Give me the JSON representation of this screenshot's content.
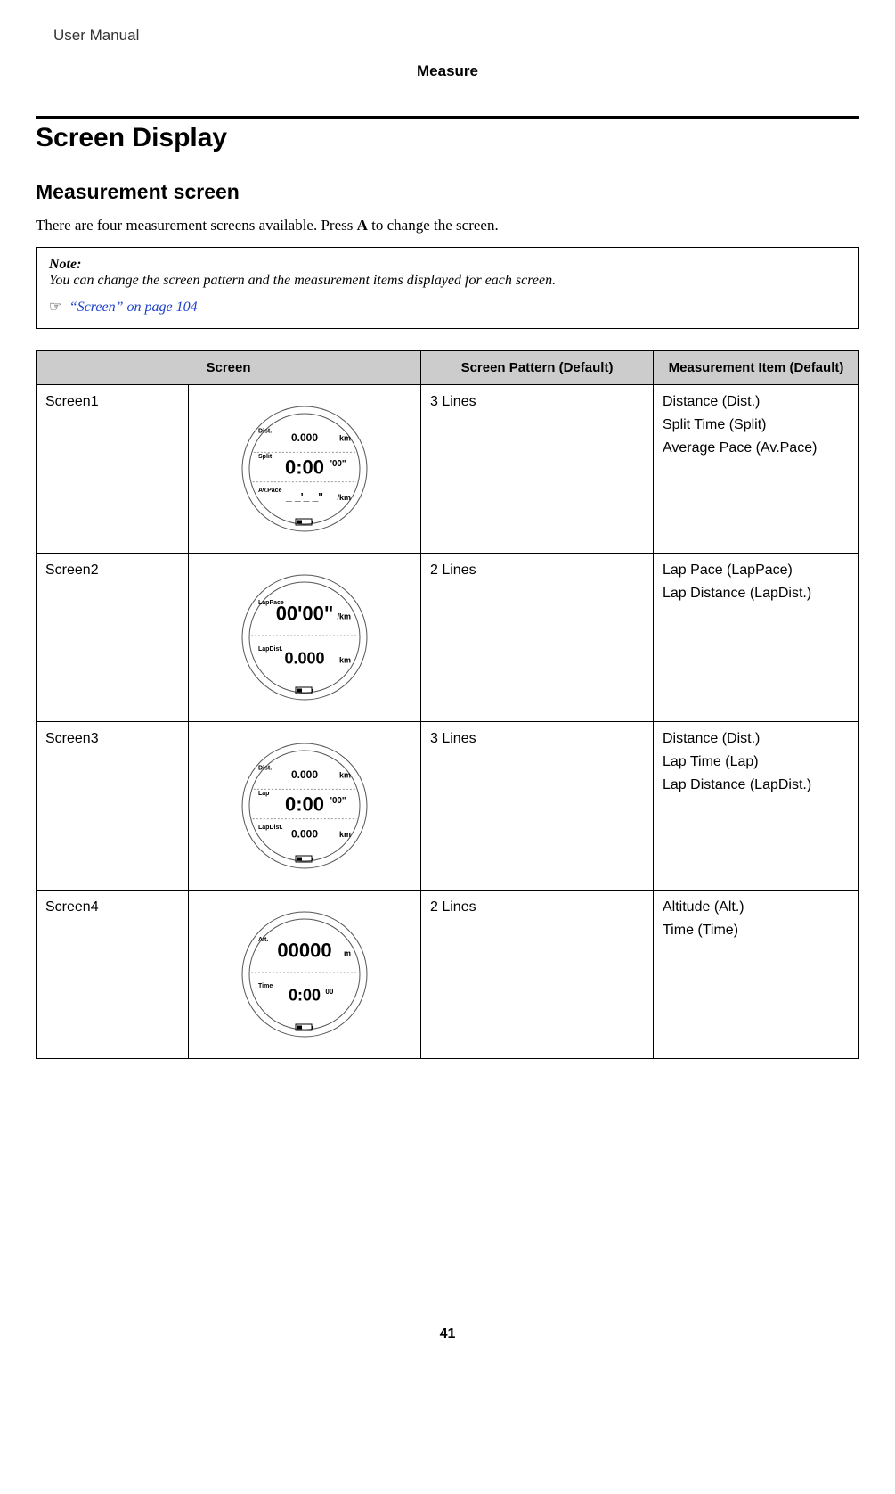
{
  "header": {
    "doc_title": "User Manual",
    "section": "Measure"
  },
  "h1": "Screen Display",
  "h2": "Measurement screen",
  "intro_prefix": "There are four measurement screens available. Press ",
  "intro_button": "A",
  "intro_suffix": " to change the screen.",
  "note": {
    "title": "Note:",
    "body": "You can change the screen pattern and the measurement items displayed for each screen.",
    "link": "“Screen” on page 104"
  },
  "table": {
    "headers": {
      "screen": "Screen",
      "pattern": "Screen Pattern (Default)",
      "item": "Measurement Item (Default)"
    },
    "rows": [
      {
        "name": "Screen1",
        "pattern": "3 Lines",
        "items": [
          "Distance (Dist.)",
          "Split Time (Split)",
          "Average Pace (Av.Pace)"
        ],
        "watch": {
          "lines": [
            {
              "label": "Dist.",
              "value": "0.000",
              "unit": "km",
              "size": "s"
            },
            {
              "label": "Split",
              "value": "0:00",
              "sup": "'00\"",
              "size": "l"
            },
            {
              "label": "Av.Pace",
              "value": "_ _'_ _\"",
              "unit": "/km",
              "size": "s"
            }
          ]
        }
      },
      {
        "name": "Screen2",
        "pattern": "2 Lines",
        "items": [
          "Lap Pace (LapPace)",
          "Lap Distance (LapDist.)"
        ],
        "watch": {
          "lines": [
            {
              "label": "LapPace",
              "value": "00'00\"",
              "unit": "/km",
              "size": "l"
            },
            {
              "label": "LapDist.",
              "value": "0.000",
              "unit": "km",
              "size": "m"
            }
          ]
        }
      },
      {
        "name": "Screen3",
        "pattern": "3 Lines",
        "items": [
          "Distance (Dist.)",
          "Lap Time (Lap)",
          "Lap Distance (LapDist.)"
        ],
        "watch": {
          "lines": [
            {
              "label": "Dist.",
              "value": "0.000",
              "unit": "km",
              "size": "s"
            },
            {
              "label": "Lap",
              "value": "0:00",
              "sup": "'00\"",
              "size": "l"
            },
            {
              "label": "LapDist.",
              "value": "0.000",
              "unit": "km",
              "size": "s"
            }
          ]
        }
      },
      {
        "name": "Screen4",
        "pattern": "2 Lines",
        "items": [
          "Altitude (Alt.)",
          "Time (Time)"
        ],
        "watch": {
          "lines": [
            {
              "label": "Alt.",
              "value": "00000",
              "unit": "m",
              "size": "l"
            },
            {
              "label": "Time",
              "value": "0:00",
              "sup": "00",
              "size": "m"
            }
          ]
        }
      }
    ]
  },
  "page_number": "41"
}
